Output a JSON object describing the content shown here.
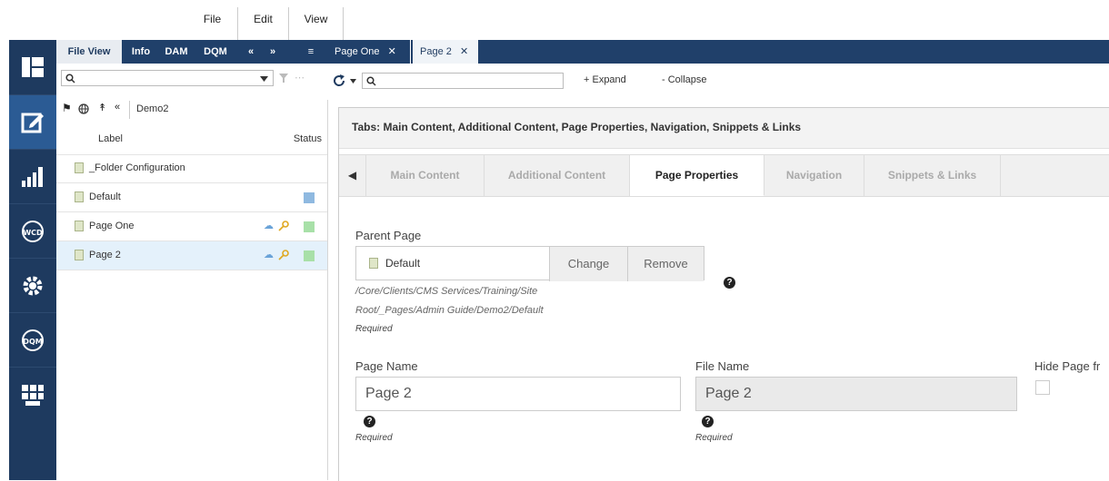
{
  "menu": {
    "items": [
      "File",
      "Edit",
      "View"
    ]
  },
  "sidebar": {
    "icons": [
      "layout-icon",
      "edit-icon",
      "analytics-icon",
      "wcd-icon",
      "settings-icon",
      "dqm-icon",
      "apps-icon"
    ],
    "labels": {
      "wcd": "WCD",
      "dqm": "DQM"
    }
  },
  "panel": {
    "tabs": [
      "File View",
      "Info",
      "DAM",
      "DQM"
    ],
    "search_placeholder": "",
    "folder_name": "Demo2",
    "columns": {
      "label": "Label",
      "status": "Status"
    },
    "rows": [
      {
        "label": "_Folder Configuration"
      },
      {
        "label": "Default"
      },
      {
        "label": "Page One"
      },
      {
        "label": "Page 2"
      }
    ]
  },
  "content_tabs": [
    {
      "label": "Page One"
    },
    {
      "label": "Page 2"
    }
  ],
  "toolbar": {
    "expand": "+ Expand",
    "collapse": "- Collapse"
  },
  "main": {
    "heading": "Tabs: Main Content, Additional Content, Page Properties, Navigation, Snippets & Links",
    "tabs": [
      "Main Content",
      "Additional Content",
      "Page Properties",
      "Navigation",
      "Snippets & Links"
    ],
    "active_tab": "Page Properties",
    "parent_page": {
      "label": "Parent Page",
      "value": "Default",
      "change": "Change",
      "remove": "Remove",
      "path_line1": "/Core/Clients/CMS Services/Training/Site",
      "path_line2": "Root/_Pages/Admin Guide/Demo2/Default",
      "required": "Required"
    },
    "page_name": {
      "label": "Page Name",
      "value": "Page 2",
      "required": "Required"
    },
    "file_name": {
      "label": "File Name",
      "value": "Page 2",
      "required": "Required"
    },
    "hide_page": {
      "label": "Hide Page fr"
    }
  },
  "colors": {
    "nav_dark": "#1e3a5f",
    "nav_active": "#2b5b94",
    "tab_bar": "#20406a",
    "status_blue": "#8fb9e0",
    "status_green": "#a8e0a8"
  }
}
